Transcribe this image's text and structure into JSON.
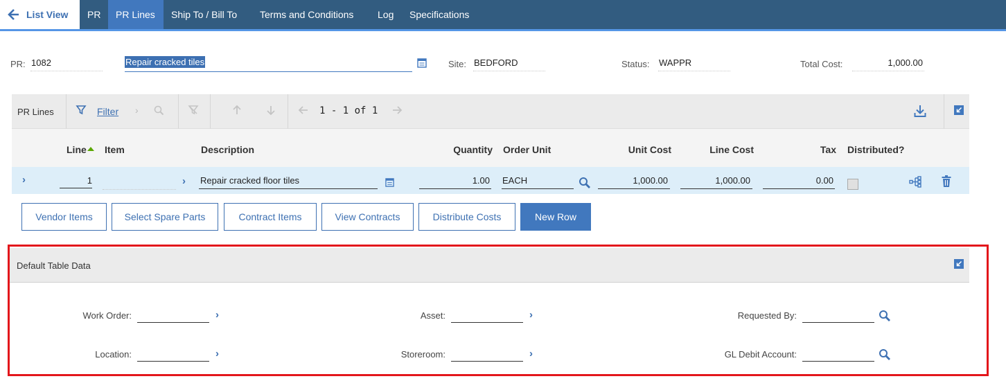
{
  "tabs": {
    "list_view": "List View",
    "pr": "PR",
    "pr_lines": "PR Lines",
    "ship_bill": "Ship To / Bill To",
    "terms": "Terms and Conditions",
    "log": "Log",
    "specs": "Specifications"
  },
  "header": {
    "pr_label": "PR:",
    "pr_value": "1082",
    "description": "Repair cracked tiles",
    "site_label": "Site:",
    "site_value": "BEDFORD",
    "status_label": "Status:",
    "status_value": "WAPPR",
    "total_cost_label": "Total Cost:",
    "total_cost_value": "1,000.00"
  },
  "table": {
    "title": "PR Lines",
    "filter_label": "Filter",
    "pagination": "1 - 1 of 1",
    "columns": {
      "line": "Line",
      "item": "Item",
      "description": "Description",
      "quantity": "Quantity",
      "order_unit": "Order Unit",
      "unit_cost": "Unit Cost",
      "line_cost": "Line Cost",
      "tax": "Tax",
      "distributed": "Distributed?"
    },
    "rows": [
      {
        "line": "1",
        "item": "",
        "description": "Repair cracked floor tiles",
        "quantity": "1.00",
        "order_unit": "EACH",
        "unit_cost": "1,000.00",
        "line_cost": "1,000.00",
        "tax": "0.00",
        "distributed": false
      }
    ]
  },
  "buttons": {
    "vendor_items": "Vendor Items",
    "select_spare_parts": "Select Spare Parts",
    "contract_items": "Contract Items",
    "view_contracts": "View Contracts",
    "distribute_costs": "Distribute Costs",
    "new_row": "New Row"
  },
  "default_table_data": {
    "title": "Default Table Data",
    "work_order_label": "Work Order:",
    "asset_label": "Asset:",
    "requested_by_label": "Requested By:",
    "location_label": "Location:",
    "storeroom_label": "Storeroom:",
    "gl_debit_label": "GL Debit Account:"
  },
  "colors": {
    "topbar": "#325c80",
    "accent": "#4178be",
    "highlight_outline": "#e3161b",
    "selected_row": "#ddeef9"
  }
}
